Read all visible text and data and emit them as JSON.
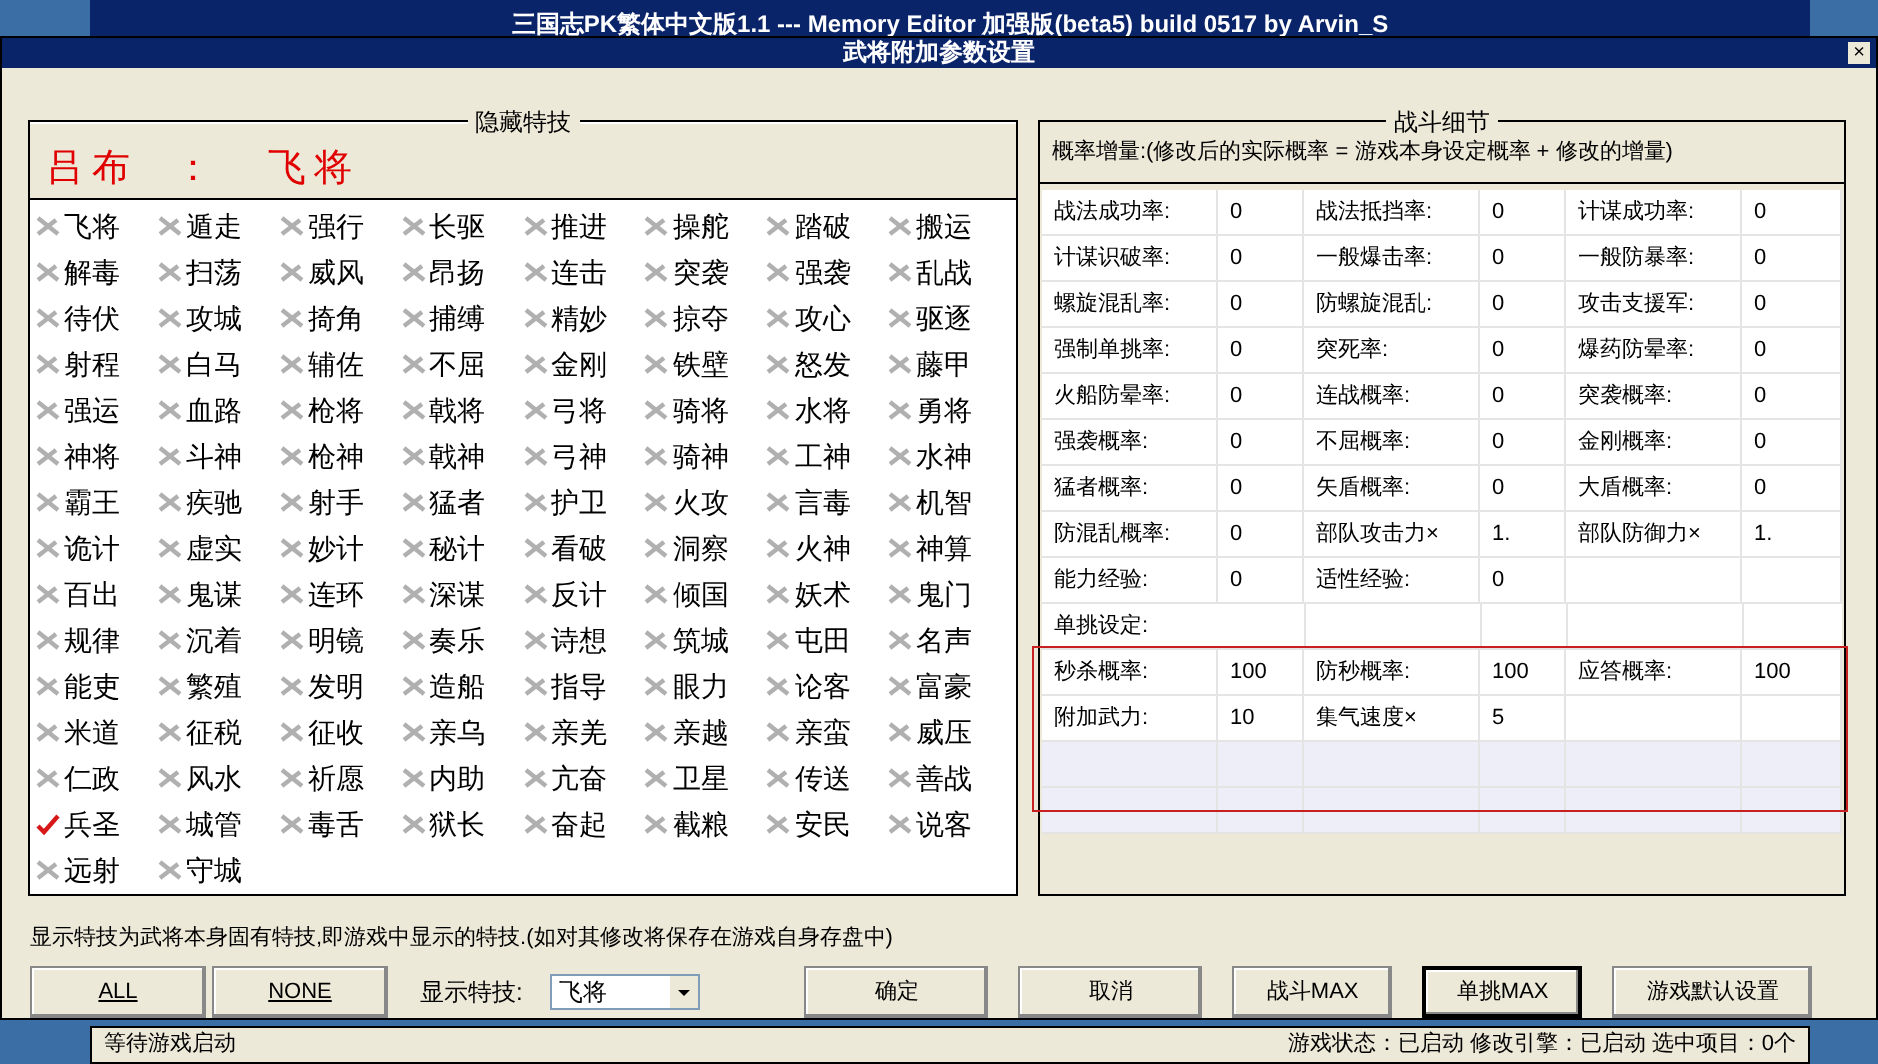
{
  "background_window": {
    "title": "三国志PK繁体中文版1.1 --- Memory Editor 加强版(beta5) build 0517 by Arvin_S"
  },
  "dialog": {
    "title": "武将附加参数设置",
    "close": "×"
  },
  "hidden_skills": {
    "legend": "隐藏特技",
    "general_name": "吕布",
    "separator": "：",
    "current_skill": "飞将",
    "skills": [
      {
        "label": "飞将",
        "checked": false
      },
      {
        "label": "遁走",
        "checked": false
      },
      {
        "label": "强行",
        "checked": false
      },
      {
        "label": "长驱",
        "checked": false
      },
      {
        "label": "推进",
        "checked": false
      },
      {
        "label": "操舵",
        "checked": false
      },
      {
        "label": "踏破",
        "checked": false
      },
      {
        "label": "搬运",
        "checked": false
      },
      {
        "label": "解毒",
        "checked": false
      },
      {
        "label": "扫荡",
        "checked": false
      },
      {
        "label": "威风",
        "checked": false
      },
      {
        "label": "昂扬",
        "checked": false
      },
      {
        "label": "连击",
        "checked": false
      },
      {
        "label": "突袭",
        "checked": false
      },
      {
        "label": "强袭",
        "checked": false
      },
      {
        "label": "乱战",
        "checked": false
      },
      {
        "label": "待伏",
        "checked": false
      },
      {
        "label": "攻城",
        "checked": false
      },
      {
        "label": "掎角",
        "checked": false
      },
      {
        "label": "捕缚",
        "checked": false
      },
      {
        "label": "精妙",
        "checked": false
      },
      {
        "label": "掠夺",
        "checked": false
      },
      {
        "label": "攻心",
        "checked": false
      },
      {
        "label": "驱逐",
        "checked": false
      },
      {
        "label": "射程",
        "checked": false
      },
      {
        "label": "白马",
        "checked": false
      },
      {
        "label": "辅佐",
        "checked": false
      },
      {
        "label": "不屈",
        "checked": false
      },
      {
        "label": "金刚",
        "checked": false
      },
      {
        "label": "铁壁",
        "checked": false
      },
      {
        "label": "怒发",
        "checked": false
      },
      {
        "label": "藤甲",
        "checked": false
      },
      {
        "label": "强运",
        "checked": false
      },
      {
        "label": "血路",
        "checked": false
      },
      {
        "label": "枪将",
        "checked": false
      },
      {
        "label": "戟将",
        "checked": false
      },
      {
        "label": "弓将",
        "checked": false
      },
      {
        "label": "骑将",
        "checked": false
      },
      {
        "label": "水将",
        "checked": false
      },
      {
        "label": "勇将",
        "checked": false
      },
      {
        "label": "神将",
        "checked": false
      },
      {
        "label": "斗神",
        "checked": false
      },
      {
        "label": "枪神",
        "checked": false
      },
      {
        "label": "戟神",
        "checked": false
      },
      {
        "label": "弓神",
        "checked": false
      },
      {
        "label": "骑神",
        "checked": false
      },
      {
        "label": "工神",
        "checked": false
      },
      {
        "label": "水神",
        "checked": false
      },
      {
        "label": "霸王",
        "checked": false
      },
      {
        "label": "疾驰",
        "checked": false
      },
      {
        "label": "射手",
        "checked": false
      },
      {
        "label": "猛者",
        "checked": false
      },
      {
        "label": "护卫",
        "checked": false
      },
      {
        "label": "火攻",
        "checked": false
      },
      {
        "label": "言毒",
        "checked": false
      },
      {
        "label": "机智",
        "checked": false
      },
      {
        "label": "诡计",
        "checked": false
      },
      {
        "label": "虚实",
        "checked": false
      },
      {
        "label": "妙计",
        "checked": false
      },
      {
        "label": "秘计",
        "checked": false
      },
      {
        "label": "看破",
        "checked": false
      },
      {
        "label": "洞察",
        "checked": false
      },
      {
        "label": "火神",
        "checked": false
      },
      {
        "label": "神算",
        "checked": false
      },
      {
        "label": "百出",
        "checked": false
      },
      {
        "label": "鬼谋",
        "checked": false
      },
      {
        "label": "连环",
        "checked": false
      },
      {
        "label": "深谋",
        "checked": false
      },
      {
        "label": "反计",
        "checked": false
      },
      {
        "label": "倾国",
        "checked": false
      },
      {
        "label": "妖术",
        "checked": false
      },
      {
        "label": "鬼门",
        "checked": false
      },
      {
        "label": "规律",
        "checked": false
      },
      {
        "label": "沉着",
        "checked": false
      },
      {
        "label": "明镜",
        "checked": false
      },
      {
        "label": "奏乐",
        "checked": false
      },
      {
        "label": "诗想",
        "checked": false
      },
      {
        "label": "筑城",
        "checked": false
      },
      {
        "label": "屯田",
        "checked": false
      },
      {
        "label": "名声",
        "checked": false
      },
      {
        "label": "能吏",
        "checked": false
      },
      {
        "label": "繁殖",
        "checked": false
      },
      {
        "label": "发明",
        "checked": false
      },
      {
        "label": "造船",
        "checked": false
      },
      {
        "label": "指导",
        "checked": false
      },
      {
        "label": "眼力",
        "checked": false
      },
      {
        "label": "论客",
        "checked": false
      },
      {
        "label": "富豪",
        "checked": false
      },
      {
        "label": "米道",
        "checked": false
      },
      {
        "label": "征税",
        "checked": false
      },
      {
        "label": "征收",
        "checked": false
      },
      {
        "label": "亲乌",
        "checked": false
      },
      {
        "label": "亲羌",
        "checked": false
      },
      {
        "label": "亲越",
        "checked": false
      },
      {
        "label": "亲蛮",
        "checked": false
      },
      {
        "label": "威压",
        "checked": false
      },
      {
        "label": "仁政",
        "checked": false
      },
      {
        "label": "风水",
        "checked": false
      },
      {
        "label": "祈愿",
        "checked": false
      },
      {
        "label": "内助",
        "checked": false
      },
      {
        "label": "亢奋",
        "checked": false
      },
      {
        "label": "卫星",
        "checked": false
      },
      {
        "label": "传送",
        "checked": false
      },
      {
        "label": "善战",
        "checked": false
      },
      {
        "label": "兵圣",
        "checked": true
      },
      {
        "label": "城管",
        "checked": false
      },
      {
        "label": "毒舌",
        "checked": false
      },
      {
        "label": "狱长",
        "checked": false
      },
      {
        "label": "奋起",
        "checked": false
      },
      {
        "label": "截粮",
        "checked": false
      },
      {
        "label": "安民",
        "checked": false
      },
      {
        "label": "说客",
        "checked": false
      },
      {
        "label": "远射",
        "checked": false
      },
      {
        "label": "守城",
        "checked": false
      }
    ]
  },
  "battle_details": {
    "legend": "战斗细节",
    "note": "概率增量:(修改后的实际概率 = 游戏本身设定概率 + 修改的增量)",
    "rows": [
      {
        "kind": "pairs",
        "cells": [
          [
            "战法成功率:",
            "0"
          ],
          [
            "战法抵挡率:",
            "0"
          ],
          [
            "计谋成功率:",
            "0"
          ]
        ]
      },
      {
        "kind": "pairs",
        "cells": [
          [
            "计谋识破率:",
            "0"
          ],
          [
            "一般爆击率:",
            "0"
          ],
          [
            "一般防暴率:",
            "0"
          ]
        ]
      },
      {
        "kind": "pairs",
        "cells": [
          [
            "螺旋混乱率:",
            "0"
          ],
          [
            "防螺旋混乱:",
            "0"
          ],
          [
            "攻击支援军:",
            "0"
          ]
        ]
      },
      {
        "kind": "pairs",
        "cells": [
          [
            "强制单挑率:",
            "0"
          ],
          [
            "突死率:",
            "0"
          ],
          [
            "爆药防晕率:",
            "0"
          ]
        ]
      },
      {
        "kind": "pairs",
        "cells": [
          [
            "火船防晕率:",
            "0"
          ],
          [
            "连战概率:",
            "0"
          ],
          [
            "突袭概率:",
            "0"
          ]
        ]
      },
      {
        "kind": "pairs",
        "cells": [
          [
            "强袭概率:",
            "0"
          ],
          [
            "不屈概率:",
            "0"
          ],
          [
            "金刚概率:",
            "0"
          ]
        ]
      },
      {
        "kind": "pairs",
        "cells": [
          [
            "猛者概率:",
            "0"
          ],
          [
            "矢盾概率:",
            "0"
          ],
          [
            "大盾概率:",
            "0"
          ]
        ]
      },
      {
        "kind": "pairs",
        "cells": [
          [
            "防混乱概率:",
            "0"
          ],
          [
            "部队攻击力×",
            "1."
          ],
          [
            "部队防御力×",
            "1."
          ]
        ]
      },
      {
        "kind": "pairs",
        "cells": [
          [
            "能力经验:",
            "0"
          ],
          [
            "适性经验:",
            "0"
          ]
        ]
      },
      {
        "kind": "heading",
        "text": "单挑设定:"
      },
      {
        "kind": "pairs",
        "cells": [
          [
            "秒杀概率:",
            "100"
          ],
          [
            "防秒概率:",
            "100"
          ],
          [
            "应答概率:",
            "100"
          ]
        ]
      },
      {
        "kind": "pairs",
        "cells": [
          [
            "附加武力:",
            "10"
          ],
          [
            "集气速度×",
            "5"
          ]
        ]
      },
      {
        "kind": "empty"
      },
      {
        "kind": "empty"
      }
    ]
  },
  "footnote": "显示特技为武将本身固有特技,即游戏中显示的特技.(如对其修改将保存在游戏自身存盘中)",
  "buttons_left": [
    "ALL",
    "NONE"
  ],
  "display_skill": {
    "label": "显示特技:",
    "value": "飞将"
  },
  "buttons_right": [
    "确定",
    "取消",
    "战斗MAX",
    "单挑MAX",
    "游戏默认设置"
  ],
  "status_bar": {
    "left": "等待游戏启动",
    "right": "游戏状态：已启动  修改引擎：已启动  选中项目：0个"
  }
}
